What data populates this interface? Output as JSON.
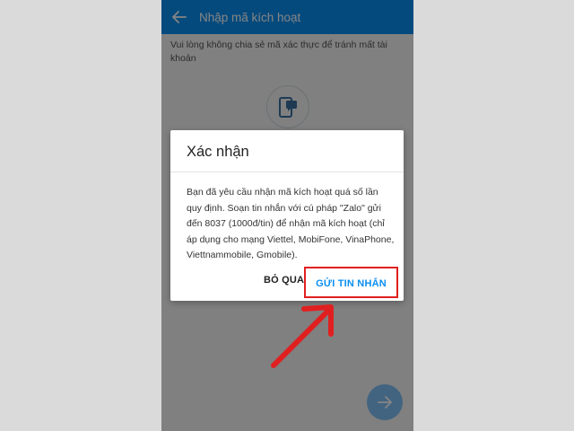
{
  "appbar": {
    "title": "Nhập mã kích hoạt",
    "back_icon": "back-arrow-icon"
  },
  "screen": {
    "hint": "Vui lòng không chia sẻ mã xác thực để tránh mất tài khoản",
    "phone_icon": "phone-message-icon",
    "next_icon": "arrow-right-icon"
  },
  "dialog": {
    "title": "Xác nhận",
    "body": "Bạn đã yêu cầu nhận mã kích hoạt quá số lần quy định. Soạn tin nhắn với cú pháp \"Zalo\" gửi đến 8037 (1000đ/tin) để nhận mã kích hoạt (chỉ áp dụng cho mạng Viettel, MobiFone, VinaPhone, Viettnammobile, Gmobile).",
    "skip_label": "BỎ QUA",
    "send_label": "GỬI TIN NHẮN"
  },
  "colors": {
    "accent": "#0a8ef0",
    "highlight": "#e02020",
    "scrim": "rgba(0,0,0,0.48)"
  }
}
